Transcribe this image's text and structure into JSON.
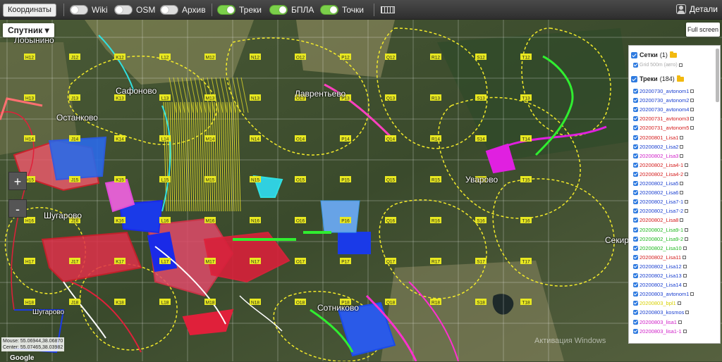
{
  "topbar": {
    "coords_label": "Координаты",
    "toggles": [
      {
        "label": "Wiki",
        "on": false
      },
      {
        "label": "OSM",
        "on": false
      },
      {
        "label": "Архив",
        "on": false
      },
      {
        "label": "Треки",
        "on": true
      },
      {
        "label": "БПЛА",
        "on": true
      },
      {
        "label": "Точки",
        "on": true
      }
    ],
    "details_label": "Детали"
  },
  "map": {
    "type_label": "Спутник",
    "fullscreen_label": "Full screen",
    "zoom_in": "+",
    "zoom_out": "-",
    "places": [
      "Лобынино",
      "Сафоново",
      "Останково",
      "Лаврентьево",
      "Уварово",
      "Шугарово",
      "Сотниково",
      "Секир",
      "Шугарово"
    ],
    "mouse_label": "Mouse: 55.06944,38.06870",
    "center_label": "Center: 55.07465,38.03982",
    "google_label": "Google",
    "watermark": "Активация Windows"
  },
  "panel": {
    "grids_label": "Сетки",
    "grids_count": "(1)",
    "grid_item": "Grid 500m (авто)",
    "tracks_label": "Треки",
    "tracks_count": "(184)",
    "tracks": [
      {
        "name": "20200730_avtonom1",
        "color": "#1a3fd0"
      },
      {
        "name": "20200730_avtonom2",
        "color": "#1a3fd0"
      },
      {
        "name": "20200730_avtonom4",
        "color": "#1a3fd0"
      },
      {
        "name": "20200731_avtonom3",
        "color": "#d41c1c"
      },
      {
        "name": "20200731_avtonom5",
        "color": "#d41c1c"
      },
      {
        "name": "20200801_Lisa1",
        "color": "#d41c1c"
      },
      {
        "name": "20200802_Lisa2",
        "color": "#1a3fd0"
      },
      {
        "name": "20200802_Lisa3",
        "color": "#d020c8"
      },
      {
        "name": "20200802_Lisa4-1",
        "color": "#d41c1c"
      },
      {
        "name": "20200802_Lisa4-2",
        "color": "#d41c1c"
      },
      {
        "name": "20200802_Lisa5",
        "color": "#1a3fd0"
      },
      {
        "name": "20200802_Lisa6",
        "color": "#1a3fd0"
      },
      {
        "name": "20200802_Lisa7-1",
        "color": "#1a3fd0"
      },
      {
        "name": "20200802_Lisa7-2",
        "color": "#1a3fd0"
      },
      {
        "name": "20200802_Lisa8",
        "color": "#d41c1c"
      },
      {
        "name": "20200802_Lisa9-1",
        "color": "#1fb81f"
      },
      {
        "name": "20200802_Lisa9-2",
        "color": "#1fb81f"
      },
      {
        "name": "20200802_Lisa10",
        "color": "#1fb81f"
      },
      {
        "name": "20200802_Lisa11",
        "color": "#d41c1c"
      },
      {
        "name": "20200802_Lisa12",
        "color": "#1a3fd0"
      },
      {
        "name": "20200802_Lisa13",
        "color": "#1a3fd0"
      },
      {
        "name": "20200802_Lisa14",
        "color": "#1a3fd0"
      },
      {
        "name": "20200803_avtonom1",
        "color": "#1a3fd0"
      },
      {
        "name": "20200803_bpl1",
        "color": "#d8d000"
      },
      {
        "name": "20200803_kosmos",
        "color": "#1a3fd0"
      },
      {
        "name": "20200803_lisa1",
        "color": "#d020c8"
      },
      {
        "name": "20200803_lisa1-1",
        "color": "#d020c8"
      }
    ]
  },
  "grid_labels": [
    "H12",
    "J12",
    "K12",
    "L12",
    "M12",
    "N12",
    "O12",
    "P12",
    "Q12",
    "R12",
    "S12",
    "T12",
    "H13",
    "J13",
    "K13",
    "L13",
    "M13",
    "N13",
    "O13",
    "P13",
    "Q13",
    "R13",
    "S13",
    "T13",
    "H14",
    "J14",
    "K14",
    "L14",
    "M14",
    "N14",
    "O14",
    "P14",
    "Q14",
    "R14",
    "S14",
    "T14",
    "H15",
    "J15",
    "K15",
    "L15",
    "M15",
    "N15",
    "O15",
    "P15",
    "Q15",
    "R15",
    "S15",
    "T15",
    "H16",
    "J16",
    "K16",
    "L16",
    "M16",
    "N16",
    "O16",
    "P16",
    "Q16",
    "R16",
    "S16",
    "T16",
    "H17",
    "J17",
    "K17",
    "L17",
    "M17",
    "N17",
    "O17",
    "P17",
    "Q17",
    "R17",
    "S17",
    "T17",
    "H18",
    "J18",
    "K18",
    "L18",
    "M18",
    "N18",
    "O18",
    "P18",
    "Q18",
    "R18",
    "S18",
    "T18"
  ]
}
